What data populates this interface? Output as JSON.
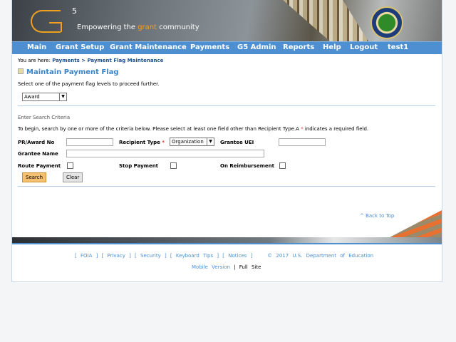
{
  "header": {
    "logo_mark": "G5",
    "tagline_pre": "Empowering the ",
    "tagline_accent": "grant",
    "tagline_post": " community",
    "seal": "Department of Education seal"
  },
  "nav": [
    "Main",
    "Grant Setup",
    "Grant Maintenance",
    "Payments",
    "G5 Admin",
    "Reports",
    "Help",
    "Logout",
    "test1"
  ],
  "breadcrumb": {
    "prefix": "You are here: ",
    "path": "Payments > Payment Flag Maintenance"
  },
  "page_title": "Maintain Payment Flag",
  "level_prompt": "Select one of the payment flag levels to proceed further.",
  "level_select": "Award",
  "search": {
    "heading": "Enter Search Criteria",
    "instructions_pre": "To begin, search by one or more of the criteria below. Please select at least one field other than Recipient Type.A ",
    "instructions_post": " indicates a required field.",
    "required_mark": "*",
    "pr_award_label": "PR/Award No",
    "pr_award_value": "",
    "recipient_type_label": "Recipient Type",
    "recipient_type_value": "Organization",
    "grantee_uei_label": "Grantee UEI",
    "grantee_uei_value": "",
    "grantee_name_label": "Grantee Name",
    "grantee_name_value": "",
    "route_payment_label": "Route Payment",
    "stop_payment_label": "Stop Payment",
    "on_reimbursement_label": "On Reimbursement",
    "search_button": "Search",
    "clear_button": "Clear"
  },
  "back_to_top": "^ Back to Top",
  "footer": {
    "links": [
      "FOIA",
      "Privacy",
      "Security",
      "Keyboard Tips",
      "Notices"
    ],
    "copyright": "© 2017 U.S. Department of Education",
    "mobile": "Mobile Version",
    "sep": "|",
    "full": "Full Site"
  },
  "colors": {
    "nav": "#4d8fd0",
    "title": "#3c84c8",
    "search_button": "#f5c070",
    "accent": "#f0a020"
  }
}
